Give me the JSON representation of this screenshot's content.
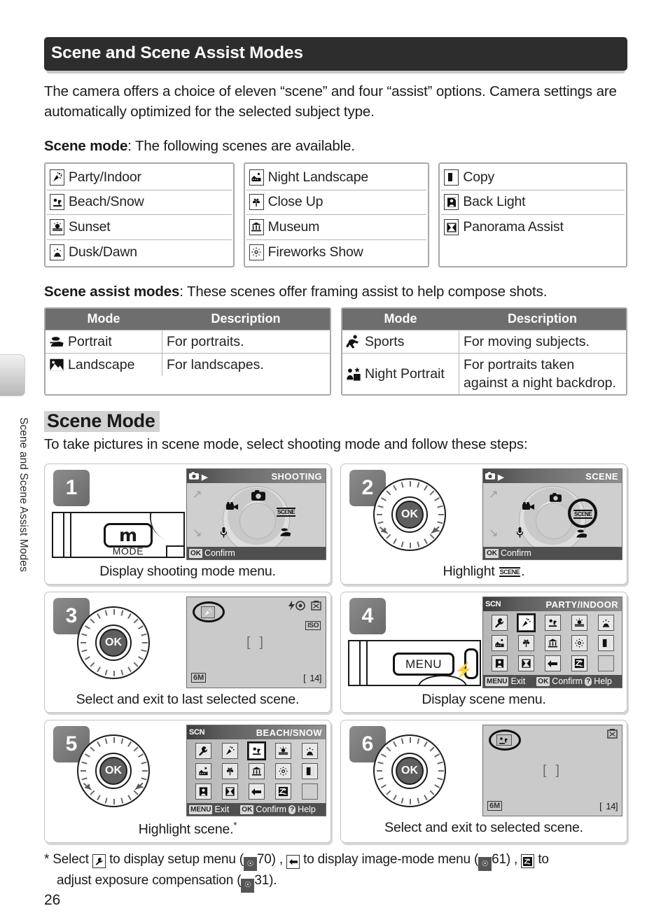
{
  "side_tab_label": "Scene and Scene Assist Modes",
  "header": {
    "title": "Scene and Scene Assist Modes"
  },
  "intro": {
    "paragraph": "The camera offers a choice of eleven “scene” and four “assist” options.  Camera settings are automatically optimized for the selected subject type.",
    "scene_mode_label": "Scene mode",
    "scene_mode_rest": ": The following scenes are available.",
    "assist_label": "Scene assist modes",
    "assist_rest": ": These scenes offer framing assist to help compose shots."
  },
  "scene_columns": [
    {
      "items": [
        {
          "label": "Party/Indoor",
          "icon": "party-indoor-icon",
          "glyph": "❇"
        },
        {
          "label": "Beach/Snow",
          "icon": "beach-snow-icon",
          "glyph": "⛱"
        },
        {
          "label": "Sunset",
          "icon": "sunset-icon",
          "glyph": "☀"
        },
        {
          "label": "Dusk/Dawn",
          "icon": "dusk-dawn-icon",
          "glyph": "▲"
        }
      ]
    },
    {
      "items": [
        {
          "label": "Night Landscape",
          "icon": "night-landscape-icon",
          "glyph": "⌂"
        },
        {
          "label": "Close Up",
          "icon": "close-up-icon",
          "glyph": "❀"
        },
        {
          "label": "Museum",
          "icon": "museum-icon",
          "glyph": "⛫"
        },
        {
          "label": "Fireworks Show",
          "icon": "fireworks-show-icon",
          "glyph": "✻"
        }
      ]
    },
    {
      "items": [
        {
          "label": "Copy",
          "icon": "copy-icon",
          "glyph": "◧"
        },
        {
          "label": "Back Light",
          "icon": "back-light-icon",
          "glyph": "◑"
        },
        {
          "label": "Panorama Assist",
          "icon": "panorama-assist-icon",
          "glyph": "⋈"
        }
      ]
    }
  ],
  "assist_tables": [
    {
      "headers": [
        "Mode",
        "Description"
      ],
      "rows": [
        {
          "mode": "Portrait",
          "icon": "portrait-icon",
          "desc": "For portraits."
        },
        {
          "mode": "Landscape",
          "icon": "landscape-icon",
          "desc": "For landscapes."
        }
      ]
    },
    {
      "headers": [
        "Mode",
        "Description"
      ],
      "rows": [
        {
          "mode": "Sports",
          "icon": "sports-icon",
          "desc": "For moving subjects."
        },
        {
          "mode": "Night Portrait",
          "icon": "night-portrait-icon",
          "desc": "For portraits taken against a night backdrop."
        }
      ]
    }
  ],
  "scene_mode_section": {
    "heading": "Scene Mode",
    "intro": "To take pictures in scene mode, select shooting mode and follow these steps:"
  },
  "steps": [
    {
      "number": "1",
      "caption": "Display shooting mode menu.",
      "illustration": "camera-back-mode-button",
      "button_label": "m",
      "button_sub": "MODE",
      "lcd": {
        "type": "mode-dial",
        "title": "SHOOTING",
        "footer": "Confirm",
        "footer_key": "OK",
        "selected": "camera"
      }
    },
    {
      "number": "2",
      "caption_pre": "Highlight",
      "caption_post": ".",
      "caption_icon": "SCENE",
      "illustration": "rotary-multi-selector-left-right",
      "ok_label": "OK",
      "lcd": {
        "type": "mode-dial",
        "title": "SCENE",
        "footer": "Confirm",
        "footer_key": "OK",
        "selected": "scene"
      }
    },
    {
      "number": "3",
      "caption": "Select and exit to last selected scene.",
      "illustration": "rotary-multi-selector-center",
      "ok_label": "OK",
      "lcd": {
        "type": "live-view",
        "mode_icon": "party-indoor-icon",
        "flash_icon": "red-eye-flash-icon",
        "battery_icon": "battery-icon",
        "iso_label": "ISO",
        "image_size": "6M",
        "shots_remaining": "14",
        "focus_brackets": "[  ]"
      }
    },
    {
      "number": "4",
      "caption": "Display scene menu.",
      "illustration": "camera-back-menu-button",
      "button_label": "MENU",
      "lcd": {
        "type": "scene-menu",
        "badge": "SCN",
        "title": "PARTY/INDOOR",
        "selected_index": 1,
        "footer_items": [
          {
            "key": "MENU",
            "label": "Exit"
          },
          {
            "key": "OK",
            "label": "Confirm"
          },
          {
            "key": "?",
            "label": "Help"
          }
        ],
        "cells": [
          "setup-icon",
          "party-indoor-icon",
          "beach-snow-icon",
          "sunset-icon",
          "dusk-dawn-icon",
          "night-landscape-icon",
          "close-up-icon",
          "museum-icon",
          "fireworks-show-icon",
          "copy-icon",
          "back-light-icon",
          "panorama-assist-icon",
          "image-mode-icon",
          "exposure-comp-icon",
          "blank"
        ]
      }
    },
    {
      "number": "5",
      "caption": "Highlight scene.",
      "caption_footnote": "*",
      "illustration": "rotary-multi-selector-left-right",
      "ok_label": "OK",
      "lcd": {
        "type": "scene-menu",
        "badge": "SCN",
        "title": "BEACH/SNOW",
        "selected_index": 2,
        "footer_items": [
          {
            "key": "MENU",
            "label": "Exit"
          },
          {
            "key": "OK",
            "label": "Confirm"
          },
          {
            "key": "?",
            "label": "Help"
          }
        ],
        "cells": [
          "setup-icon",
          "party-indoor-icon",
          "beach-snow-icon",
          "sunset-icon",
          "dusk-dawn-icon",
          "night-landscape-icon",
          "close-up-icon",
          "museum-icon",
          "fireworks-show-icon",
          "copy-icon",
          "back-light-icon",
          "panorama-assist-icon",
          "image-mode-icon",
          "exposure-comp-icon",
          "blank"
        ]
      }
    },
    {
      "number": "6",
      "caption": "Select and exit to selected scene.",
      "illustration": "rotary-multi-selector-center",
      "ok_label": "OK",
      "lcd": {
        "type": "live-view",
        "mode_icon": "beach-snow-icon",
        "battery_icon": "battery-icon",
        "image_size": "6M",
        "shots_remaining": "14",
        "focus_brackets": "[  ]"
      }
    }
  ],
  "footnote": {
    "line1_a": "* Select",
    "line1_b": "to display setup menu (",
    "ref1": "70",
    "line1_c": ") ,",
    "line1_d": "to display image-mode menu (",
    "ref2": "61",
    "line1_e": ") ,",
    "line1_f": "to",
    "line2_a": "adjust exposure compensation (",
    "ref3": "31",
    "line2_b": ")."
  },
  "page_number": "26",
  "colors": {
    "header_bg": "#2d2d2d",
    "table_header_bg": "#6e6e6e",
    "step_number_bg": "#7a7a7a",
    "highlight_bg": "#d2d2d2"
  }
}
